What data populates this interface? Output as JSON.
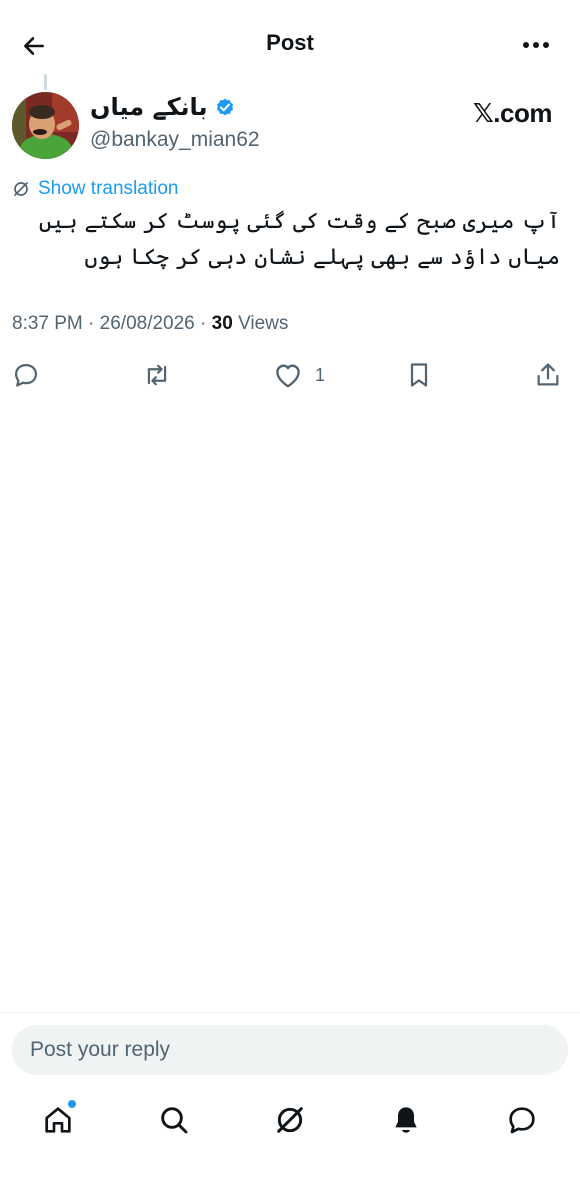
{
  "header": {
    "title": "Post",
    "back_icon": "arrow-left-icon",
    "more_icon": "more-horizontal-icon"
  },
  "author": {
    "name": "بانکے میاں",
    "handle": "@bankay_mian62",
    "verified": true,
    "verified_color": "#1d9bf0"
  },
  "source": {
    "label": "𝕏.com"
  },
  "translation": {
    "label": "Show translation",
    "icon": "grok-icon"
  },
  "post": {
    "lines": [
      "آپ میری صبح کے وقت کی گئی پوسٹ کر سکتے ہیں",
      "میاں داؤد سے بھی پہلے نشان دہی کر چکا ہوں"
    ]
  },
  "meta": {
    "time": "8:37 PM",
    "date": "26/08/2026",
    "views_count": "30",
    "views_label": "Views"
  },
  "actions": {
    "reply_icon": "reply-icon",
    "repost_icon": "repost-icon",
    "like_icon": "heart-icon",
    "like_count": "1",
    "bookmark_icon": "bookmark-icon",
    "share_icon": "share-icon"
  },
  "composer": {
    "placeholder": "Post your reply"
  },
  "nav": {
    "items": [
      "home-icon",
      "search-icon",
      "grok-icon",
      "notifications-icon",
      "messages-icon"
    ],
    "home_has_dot": true,
    "accent": "#1d9bf0"
  },
  "colors": {
    "text": "#0f1419",
    "secondary": "#536471",
    "link": "#1d9bf0",
    "border": "#eff3f4"
  }
}
